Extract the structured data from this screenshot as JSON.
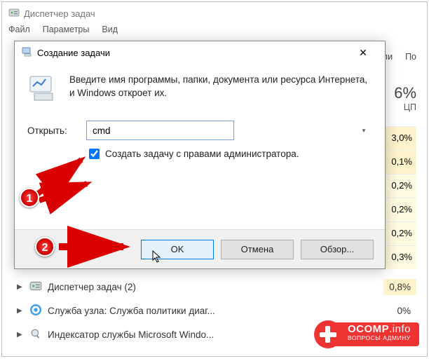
{
  "task_manager": {
    "title": "Диспетчер задач",
    "menu": [
      "Файл",
      "Параметры",
      "Вид"
    ],
    "header_cols": [
      "ели",
      "По"
    ],
    "cpu": {
      "percent": "6%",
      "label": "ЦП"
    },
    "rows_pct": [
      "3,0%",
      "0,1%",
      "0,2%",
      "0,2%",
      "0,2%",
      "0,3%"
    ],
    "processes": [
      {
        "name": "Диспетчер задач (2)",
        "pct": "0,8%",
        "expandable": true
      },
      {
        "name": "Служба узла: Служба политики диаг...",
        "pct": "0%",
        "expandable": true
      },
      {
        "name": "Индексатор службы Microsoft Windo...",
        "pct": "",
        "expandable": true
      }
    ]
  },
  "dialog": {
    "title": "Создание задачи",
    "message": "Введите имя программы, папки, документа или ресурса Интернета, и Windows откроет их.",
    "open_label": "Открыть:",
    "open_value": "cmd",
    "admin_checkbox_label": "Создать задачу с правами администратора.",
    "admin_checked": true,
    "buttons": {
      "ok": "OK",
      "cancel": "Отмена",
      "browse": "Обзор..."
    }
  },
  "annotations": {
    "marker1": "1",
    "marker2": "2"
  },
  "badge": {
    "line1a": "OCOMP",
    "line1b": ".info",
    "line2": "ВОПРОСЫ АДМИНУ"
  }
}
